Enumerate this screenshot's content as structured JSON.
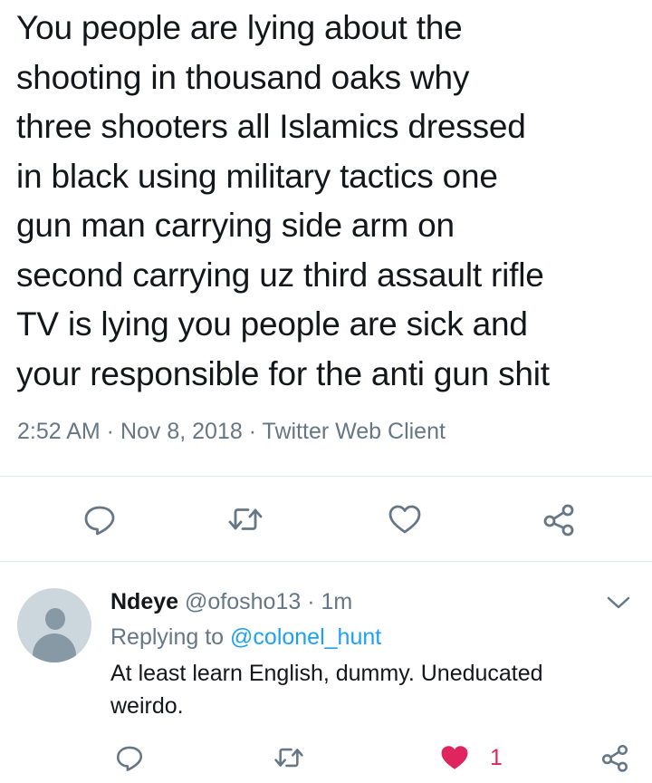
{
  "tweet": {
    "text": "You  people are lying about the\nshooting in thousand oaks why\nthree  shooters all Islamics dressed\nin black using military tactics one\ngun  man carrying side arm on\nsecond carrying uz third assault rifle\nTV is  lying you people are sick and\nyour responsible for the anti gun shit",
    "time": "2:52 AM",
    "date": "Nov 8, 2018",
    "source": "Twitter Web Client",
    "meta_sep": " · "
  },
  "actions": {
    "reply_icon": "reply-icon",
    "retweet_icon": "retweet-icon",
    "like_icon": "heart-icon",
    "share_icon": "share-icon"
  },
  "reply": {
    "name": "Ndeye",
    "handle": "@ofosho13",
    "sep": " · ",
    "time": "1m",
    "replying_prefix": "Replying to ",
    "replying_to": "@colonel_hunt",
    "text": "At least learn English, dummy. Uneducated weirdo.",
    "like_count": "1"
  },
  "colors": {
    "icon_gray": "#657786",
    "link_blue": "#1da1f2",
    "like_red": "#e0245e"
  }
}
